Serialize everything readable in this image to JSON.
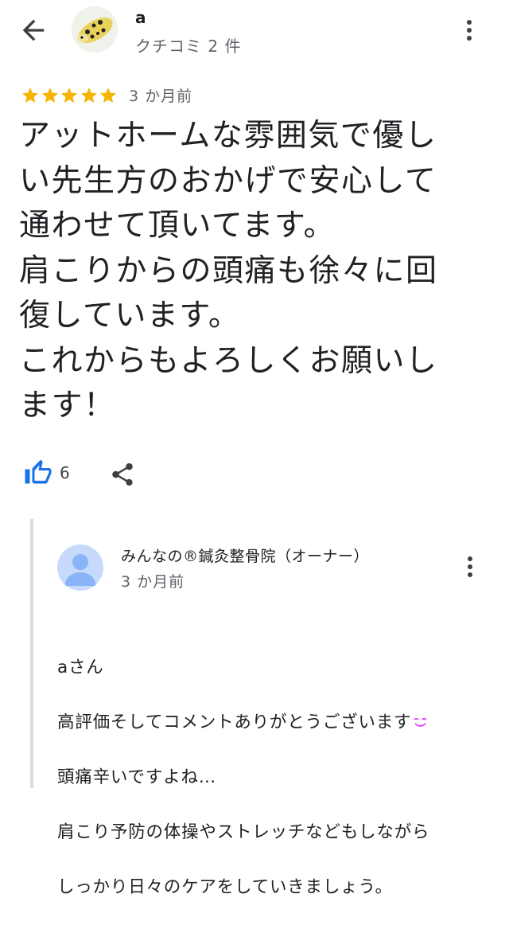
{
  "header": {
    "user_name": "a",
    "user_sub": "クチコミ 2 件"
  },
  "review": {
    "rating": 5,
    "date": "3 か月前",
    "text": "アットホームな雰囲気で優し\nい先生方のおかげで安心して\n通わせて頂いてます。\n肩こりからの頭痛も徐々に回\n復しています。\nこれからもよろしくお願いし\nます！",
    "like_count": "6"
  },
  "reply": {
    "owner_name": "みんなの®鍼灸整骨院（オーナー）",
    "date": "3 か月前",
    "line1": "aさん",
    "line2": "高評価そしてコメントありがとうございます",
    "line3": "頭痛辛いですよね…",
    "line4": "肩こり予防の体操やストレッチなどもしながら",
    "line5": "しっかり日々のケアをしていきましょう。"
  },
  "colors": {
    "star": "#F4B400",
    "like": "#1A73E8",
    "text": "#202124",
    "muted": "#5F6368",
    "owner_avatar_bg": "#C6DAFC",
    "owner_avatar_fg": "#8AB4F8",
    "emoji": "#E040FB"
  },
  "icons": {
    "back": "arrow-left-icon",
    "more": "more-vert-icon",
    "like": "thumb-up-icon",
    "share": "share-icon",
    "star": "star-icon",
    "owner_avatar": "person-icon",
    "emoji": "smiling-face-icon"
  }
}
